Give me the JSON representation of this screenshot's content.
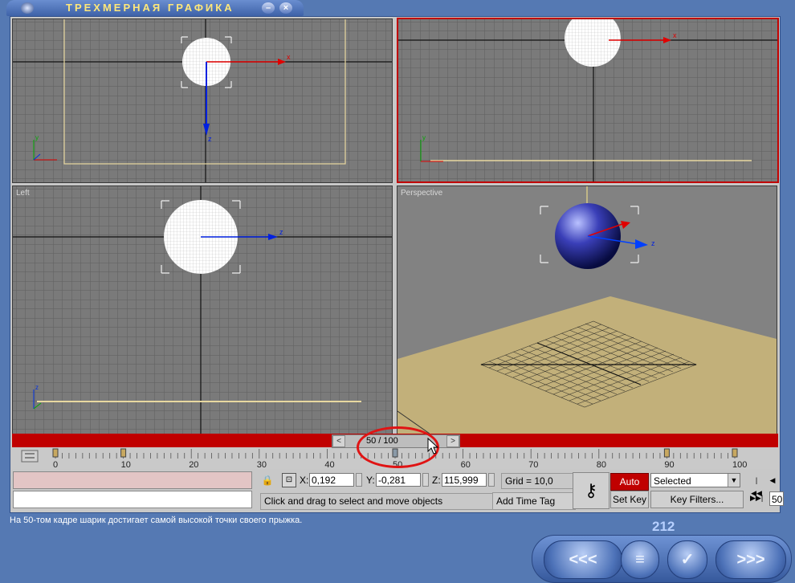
{
  "window": {
    "title": "ТРЕХМЕРНАЯ ГРАФИКА",
    "minimize_glyph": "–",
    "close_glyph": "×"
  },
  "viewports": {
    "top": {
      "label": ""
    },
    "front": {
      "label": ""
    },
    "left": {
      "label": "Left"
    },
    "perspective": {
      "label": "Perspective"
    },
    "axis_labels": {
      "x": "x",
      "y": "y",
      "z": "z"
    }
  },
  "timeline": {
    "frame_display": "50 / 100",
    "prev_glyph": "<",
    "next_glyph": ">",
    "ticks": [
      "0",
      "10",
      "20",
      "30",
      "40",
      "50",
      "60",
      "70",
      "80",
      "90",
      "100"
    ]
  },
  "status": {
    "x_label": "X:",
    "x_value": "0,192",
    "y_label": "Y:",
    "y_value": "-0,281",
    "z_label": "Z:",
    "z_value": "115,999",
    "grid": "Grid = 10,0",
    "prompt": "Click and drag to select and move objects",
    "add_time_tag": "Add Time Tag",
    "auto_key": "Auto Key",
    "set_key": "Set Key",
    "selected": "Selected",
    "key_filters": "Key Filters...",
    "frame_field": "50"
  },
  "lesson": {
    "caption": "На 50-том кадре шарик достигает самой высокой точки своего прыжка.",
    "page_number": "212"
  },
  "nav": {
    "back_glyph": "<<<",
    "menu_glyph": "≡",
    "check_glyph": "✓",
    "forward_glyph": ">>>"
  },
  "colors": {
    "frame_blue": "#5579b3",
    "timeline_red": "#c00000",
    "viewport_gray": "#7a7a7a",
    "title_yellow": "#ffe87a",
    "highlight_circle": "#e01414"
  }
}
